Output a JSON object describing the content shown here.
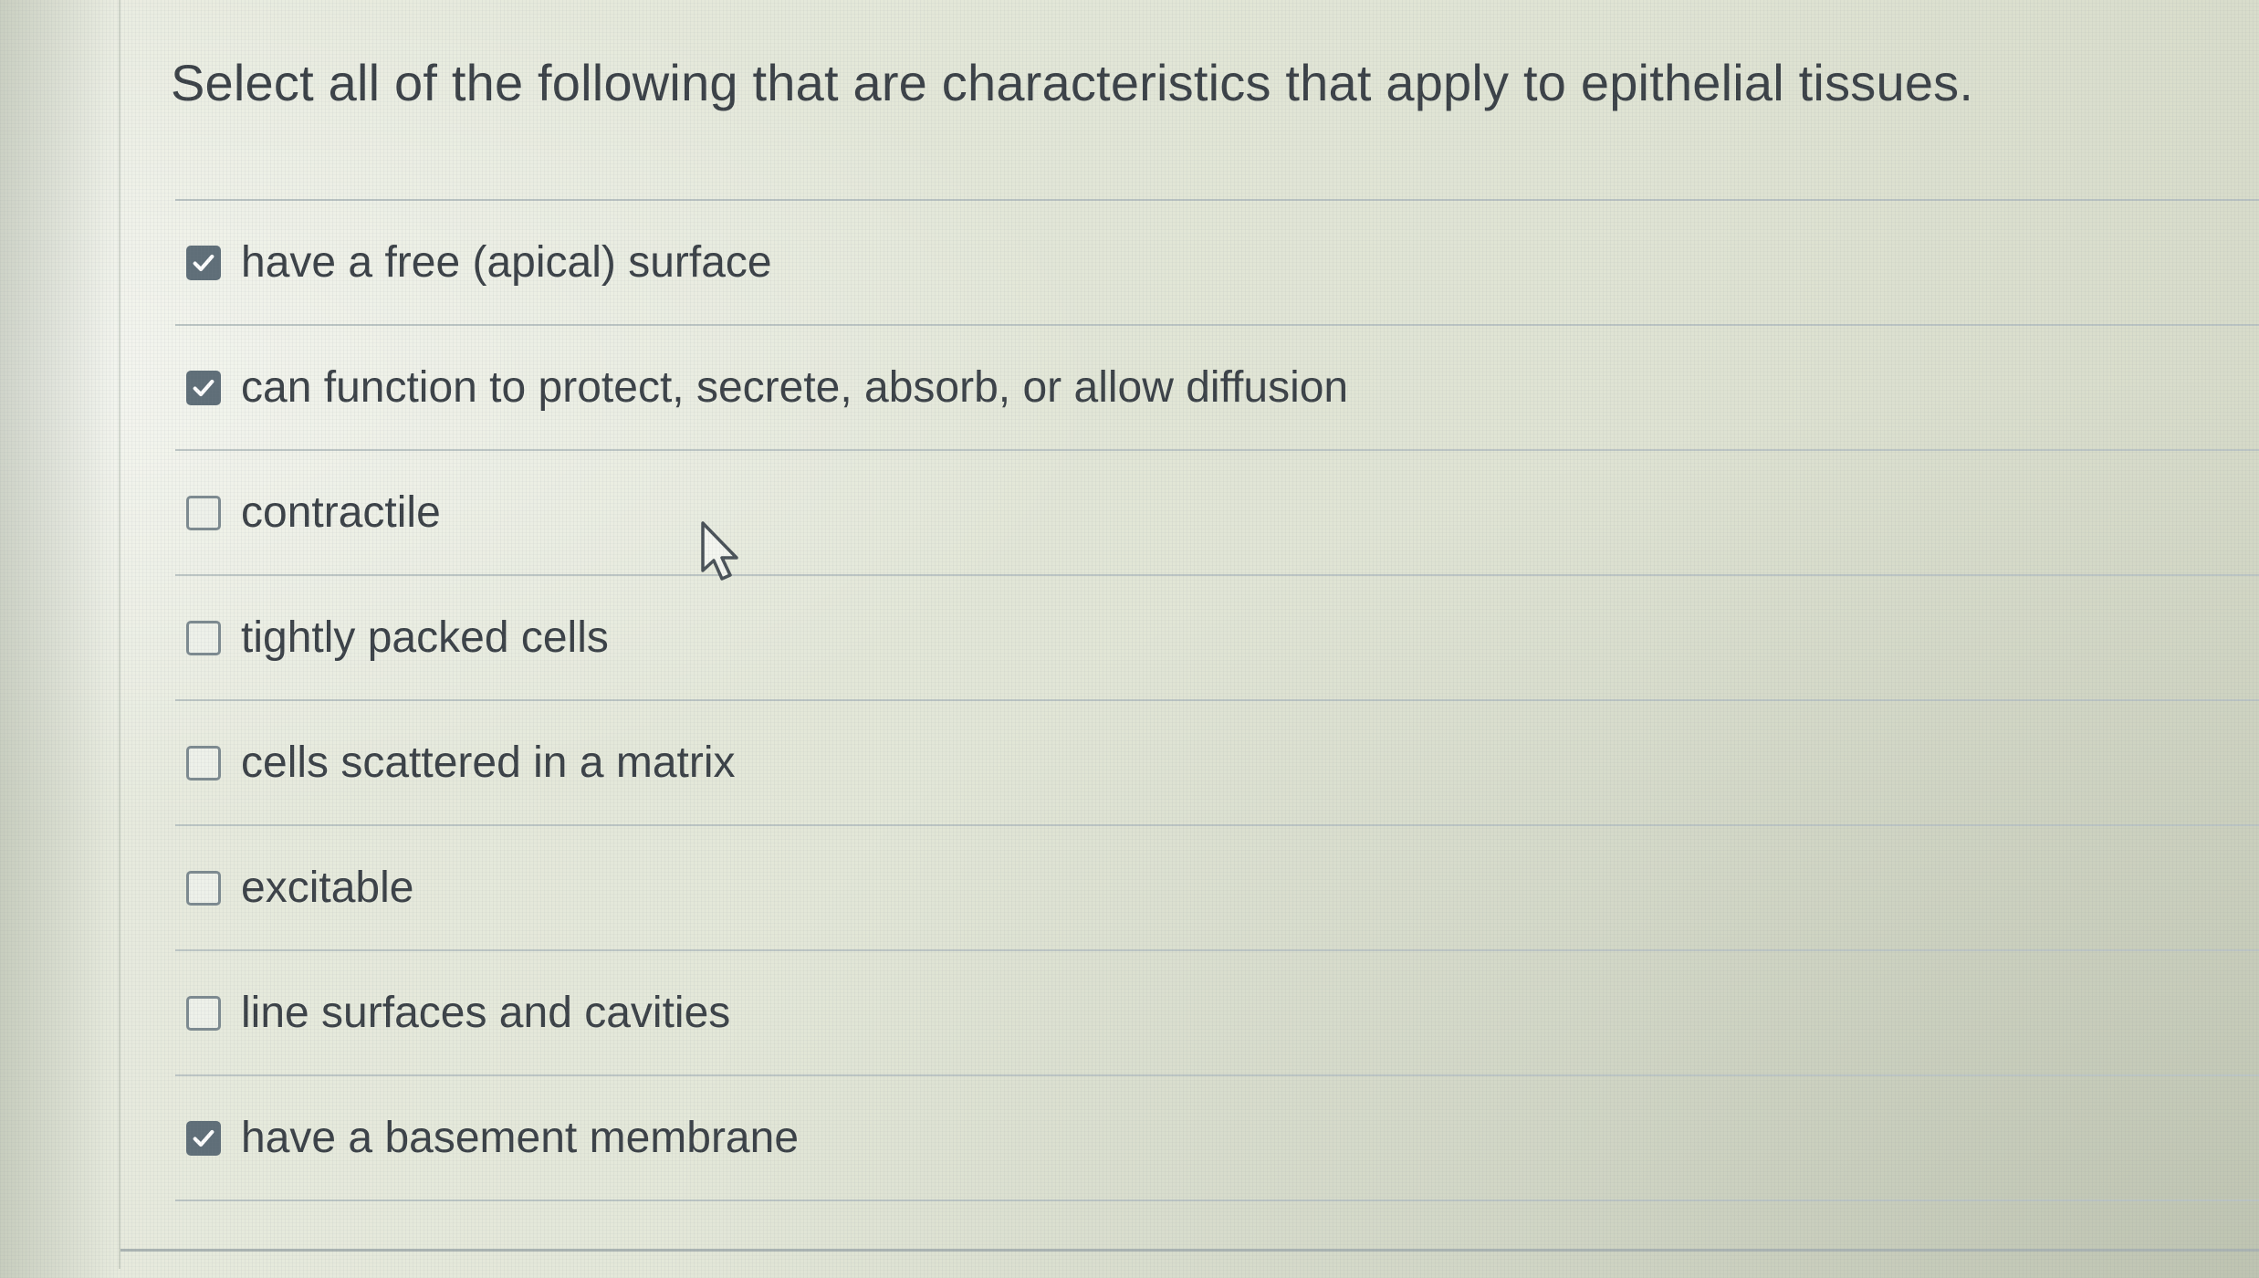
{
  "question": {
    "prompt": "Select all of the following that are characteristics that apply to epithelial tissues."
  },
  "options": [
    {
      "label": "have a free (apical) surface",
      "checked": true
    },
    {
      "label": "can function to protect, secrete, absorb, or allow diffusion",
      "checked": true
    },
    {
      "label": "contractile",
      "checked": false
    },
    {
      "label": "tightly packed cells",
      "checked": false
    },
    {
      "label": "cells scattered in a matrix",
      "checked": false
    },
    {
      "label": "excitable",
      "checked": false
    },
    {
      "label": "line surfaces and cavities",
      "checked": false
    },
    {
      "label": "have a basement membrane",
      "checked": true
    }
  ],
  "icons": {
    "checkbox_checked": "checkmark-icon",
    "cursor": "mouse-pointer-icon"
  },
  "colors": {
    "text": "#3b4147",
    "checkbox_checked_fill": "#5f6e78",
    "checkbox_border": "#7d8a90",
    "divider": "#bcc5c4"
  }
}
